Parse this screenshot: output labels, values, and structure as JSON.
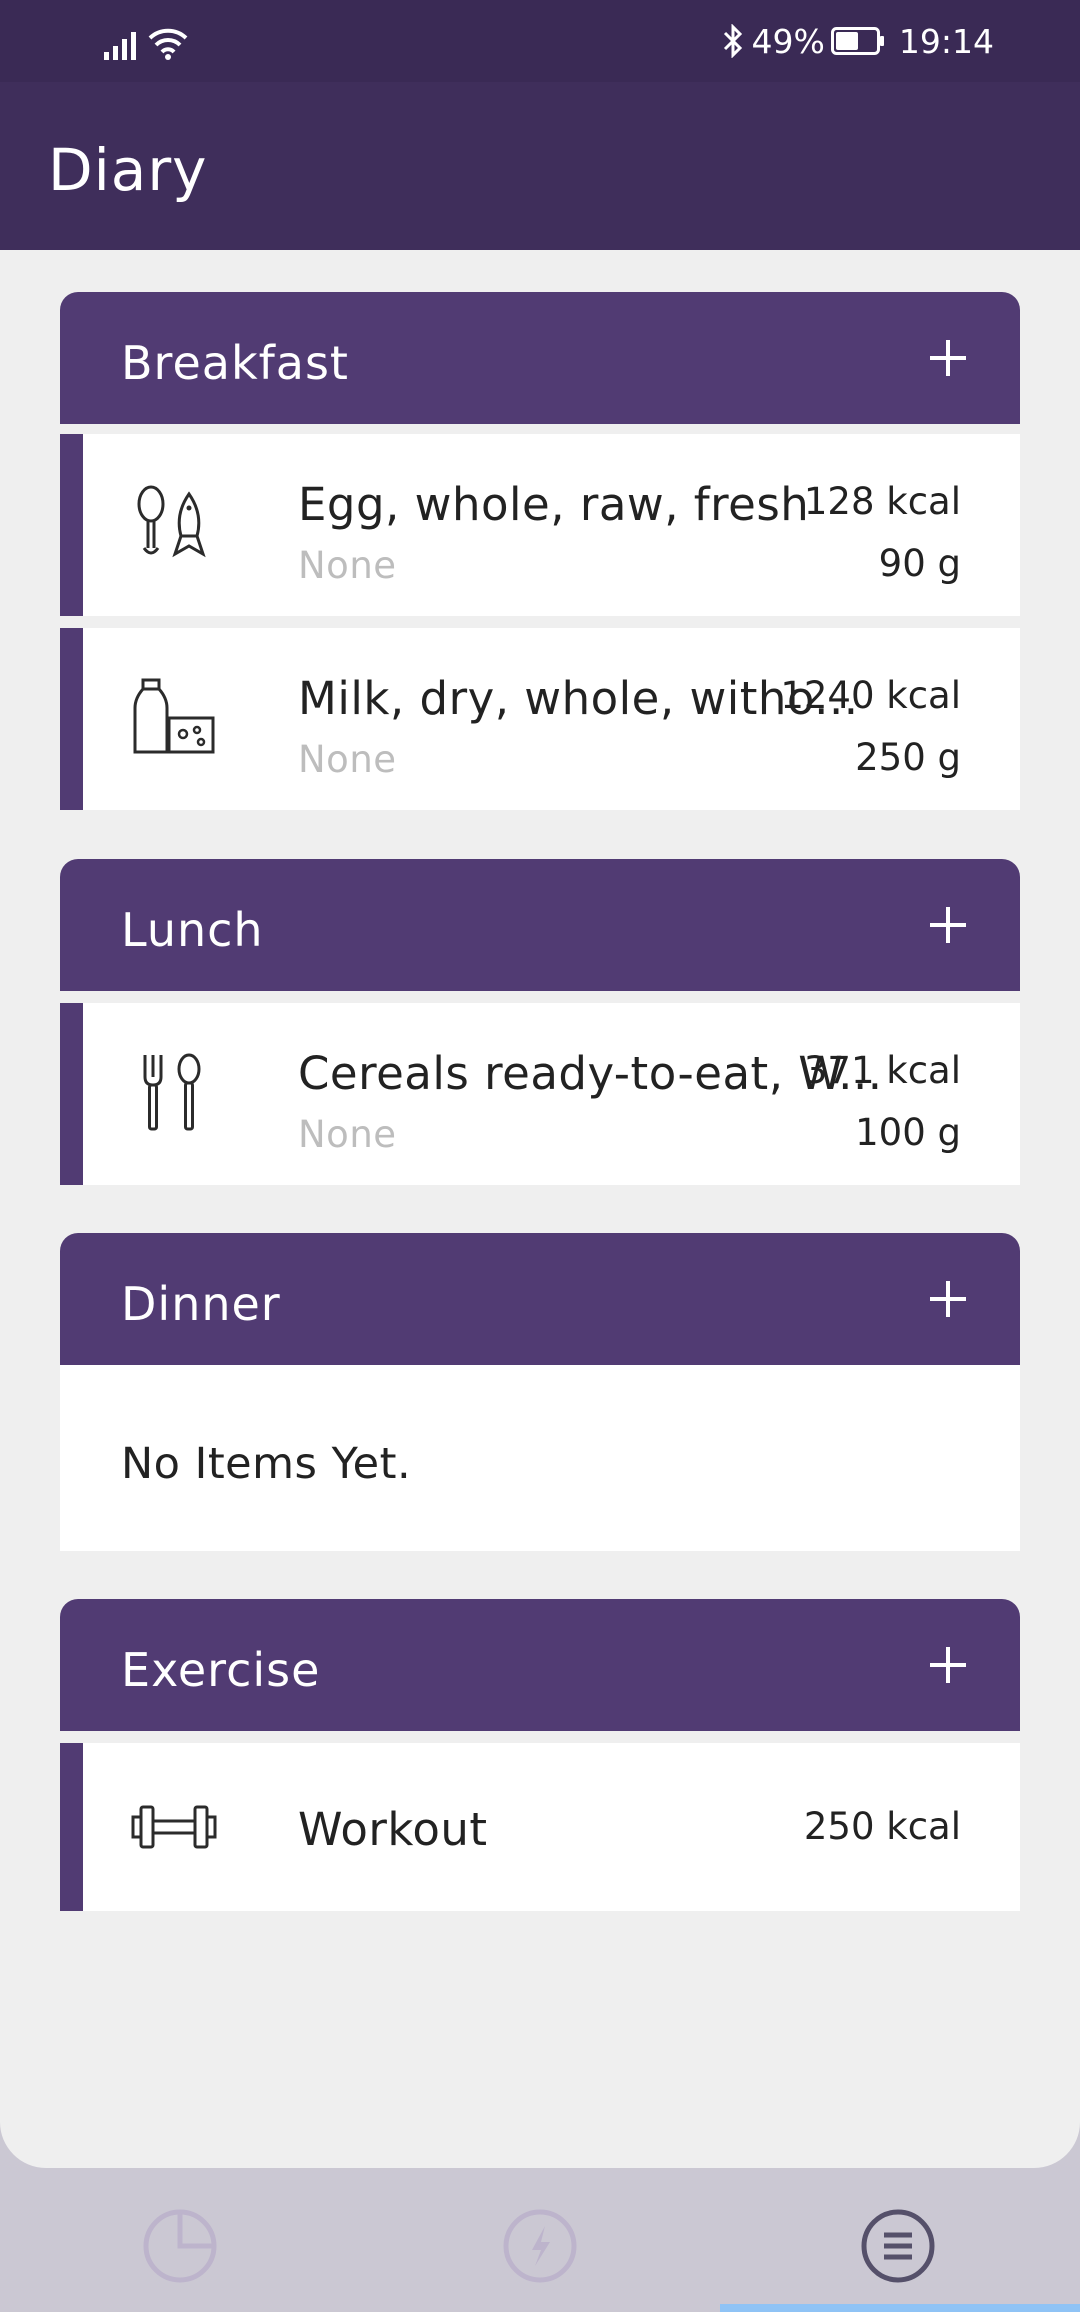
{
  "status_bar": {
    "battery": "49%",
    "time": "19:14",
    "icons": [
      "signal-icon",
      "wifi-icon",
      "bluetooth-icon",
      "battery-icon"
    ]
  },
  "app_bar": {
    "title": "Diary"
  },
  "colors": {
    "primary": "#513b73",
    "app_bar": "#3f2e5b",
    "status_bar": "#3a2a55",
    "background": "#efefef",
    "nav_background": "#cbc8d3",
    "nav_indicator": "#8fc3f5",
    "muted_text": "#bdbdbd"
  },
  "sections": [
    {
      "title": "Breakfast",
      "items": [
        {
          "name": "Egg, whole, raw, fresh",
          "sub": "None",
          "kcal": "128 kcal",
          "weight": "90 g",
          "icon": "meat-fish-icon"
        },
        {
          "name": "Milk, dry, whole, witho...",
          "sub": "None",
          "kcal": "1240 kcal",
          "weight": "250 g",
          "icon": "milk-cheese-icon"
        }
      ]
    },
    {
      "title": "Lunch",
      "items": [
        {
          "name": "Cereals ready-to-eat, W...",
          "sub": "None",
          "kcal": "371 kcal",
          "weight": "100 g",
          "icon": "fork-spoon-icon"
        }
      ]
    },
    {
      "title": "Dinner",
      "empty_text": "No Items Yet."
    },
    {
      "title": "Exercise",
      "items": [
        {
          "name": "Workout",
          "kcal": "250 kcal",
          "icon": "dumbbell-icon"
        }
      ]
    }
  ],
  "bottom_nav": {
    "items": [
      "pie-chart-icon",
      "energy-icon",
      "list-icon"
    ],
    "active": "list-icon"
  }
}
